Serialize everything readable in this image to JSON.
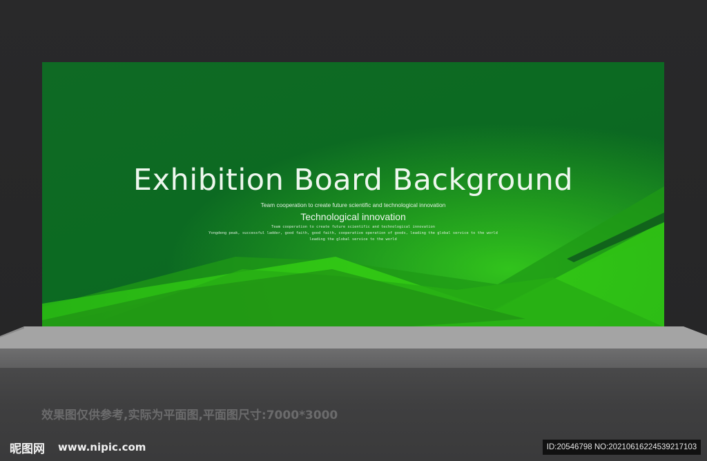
{
  "board": {
    "title": "Exhibition Board Background",
    "line1": "Team cooperation to create future scientific and technological innovation",
    "heading": "Technological innovation",
    "line2": "Team cooperation to create future scientific and technological innovation",
    "line3": "Yongdeng peak, successful ladder, good faith, good faith, cooperative operation of goods, leading the global service to the world",
    "line4": "leading the global service to the world"
  },
  "caption": "效果图仅供参考,实际为平面图,平面图尺寸:7000*3000",
  "watermark": {
    "logo": "昵图网",
    "url": "www.nipic.com",
    "id": "ID:20546798 NO:20210616224539217103"
  },
  "colors": {
    "board_green": "#0f6a24",
    "wave_green": "#2ec814",
    "dark_wall": "#29292a",
    "stage_grey": "#a3a3a3"
  }
}
